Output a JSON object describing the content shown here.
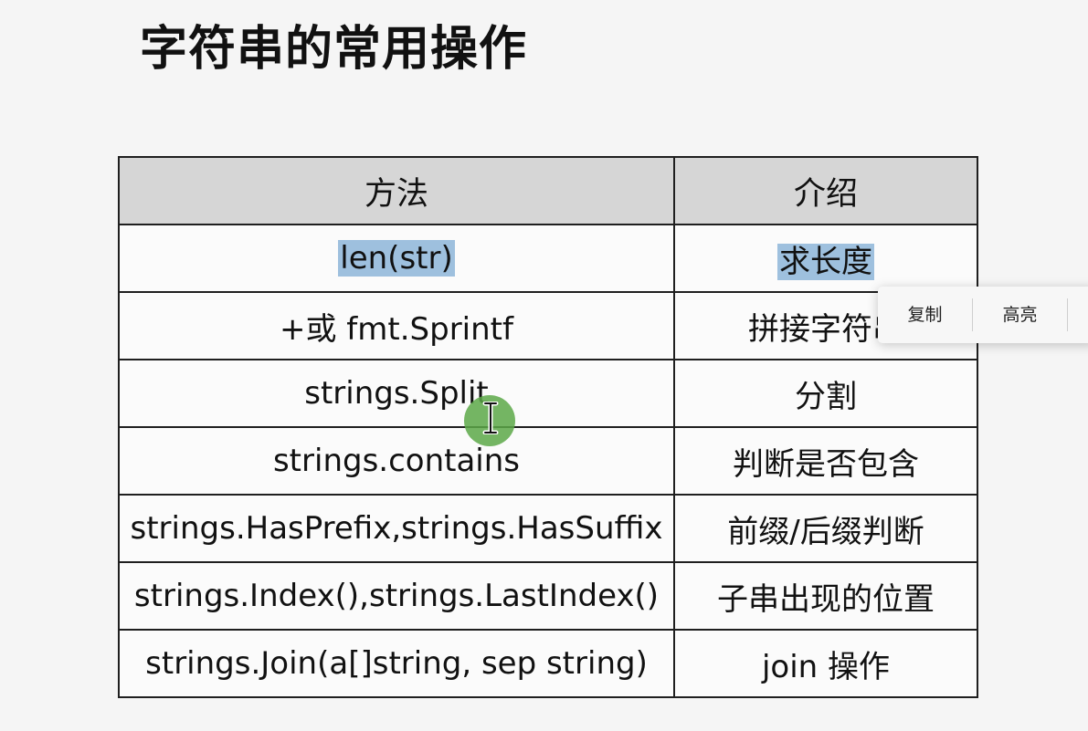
{
  "slide": {
    "title": "字符串的常用操作"
  },
  "table": {
    "headers": [
      "方法",
      "介绍"
    ],
    "rows": [
      {
        "method": "len(str)",
        "desc": "求长度"
      },
      {
        "method": "+或 fmt.Sprintf",
        "desc": "拼接字符串"
      },
      {
        "method": "strings.Split",
        "desc": "分割"
      },
      {
        "method": "strings.contains",
        "desc": "判断是否包含"
      },
      {
        "method": "strings.HasPrefix,strings.HasSuffix",
        "desc": "前缀/后缀判断"
      },
      {
        "method": "strings.Index(),strings.LastIndex()",
        "desc": "子串出现的位置"
      },
      {
        "method": "strings.Join(a[]string, sep string)",
        "desc": "join 操作"
      }
    ]
  },
  "context_menu": {
    "items": [
      "复制",
      "高亮"
    ]
  },
  "colors": {
    "header_bg": "#d6d6d6",
    "selection": "#9ec0de",
    "cursor_highlight": "#5ca848"
  },
  "icons": {
    "cursor": "text-ibeam-icon"
  }
}
